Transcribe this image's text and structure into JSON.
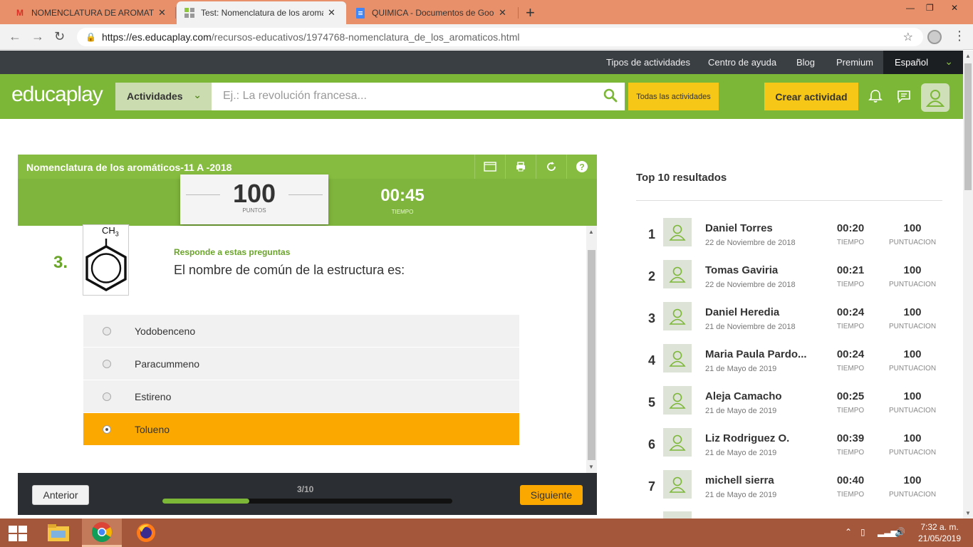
{
  "browser": {
    "tabs": [
      {
        "title": "NOMENCLATURA DE AROMATIC",
        "icon": "gmail-icon"
      },
      {
        "title": "Test: Nomenclatura de los aromá",
        "icon": "educaplay-icon",
        "active": true
      },
      {
        "title": "QUIMICA - Documentos de Goo",
        "icon": "docs-icon"
      }
    ],
    "url_domain": "https://es.educaplay.com",
    "url_path": "/recursos-educativos/1974768-nomenclatura_de_los_aromaticos.html"
  },
  "topnav": {
    "links": [
      "Tipos de actividades",
      "Centro de ayuda",
      "Blog",
      "Premium"
    ],
    "language": "Español"
  },
  "header": {
    "logo_left": "educa",
    "logo_right": "play",
    "activities_label": "Actividades",
    "search_placeholder": "Ej.: La revolución francesa...",
    "all_activities": "Todas las actividades",
    "create_label": "Crear actividad"
  },
  "quiz": {
    "title": "Nomenclatura de los aromáticos-11 A -2018",
    "score": "100",
    "score_label": "PUNTOS",
    "time": "00:45",
    "time_label": "TIEMPO",
    "question_number": "3.",
    "structure_label": "CH",
    "structure_sub": "3",
    "hint": "Responde a estas preguntas",
    "question": "El nombre de común de la estructura es:",
    "options": [
      {
        "label": "Yodobenceno",
        "selected": false
      },
      {
        "label": "Paracummeno",
        "selected": false
      },
      {
        "label": "Estireno",
        "selected": false
      },
      {
        "label": "Tolueno",
        "selected": true
      }
    ],
    "prev_label": "Anterior",
    "next_label": "Siguiente",
    "progress_text": "3/10",
    "progress_fraction": 0.3
  },
  "leaderboard": {
    "title": "Top 10 resultados",
    "time_label": "TIEMPO",
    "points_label": "PUNTUACION",
    "entries": [
      {
        "rank": "1",
        "name": "Daniel Torres",
        "date": "22 de Noviembre de 2018",
        "time": "00:20",
        "points": "100"
      },
      {
        "rank": "2",
        "name": "Tomas Gaviria",
        "date": "22 de Noviembre de 2018",
        "time": "00:21",
        "points": "100"
      },
      {
        "rank": "3",
        "name": "Daniel Heredia",
        "date": "21 de Noviembre de 2018",
        "time": "00:24",
        "points": "100"
      },
      {
        "rank": "4",
        "name": "Maria Paula Pardo...",
        "date": "21 de Mayo de 2019",
        "time": "00:24",
        "points": "100"
      },
      {
        "rank": "5",
        "name": "Aleja Camacho",
        "date": "21 de Mayo de 2019",
        "time": "00:25",
        "points": "100"
      },
      {
        "rank": "6",
        "name": "Liz Rodriguez O.",
        "date": "21 de Mayo de 2019",
        "time": "00:39",
        "points": "100"
      },
      {
        "rank": "7",
        "name": "michell sierra",
        "date": "21 de Mayo de 2019",
        "time": "00:40",
        "points": "100"
      }
    ]
  },
  "taskbar": {
    "time": "7:32 a. m.",
    "date": "21/05/2019"
  },
  "colors": {
    "brand_green": "#7cb738",
    "accent_yellow": "#f6c716",
    "selected_orange": "#fba900",
    "tabbar": "#e8906a",
    "taskbar": "#a5573b"
  }
}
